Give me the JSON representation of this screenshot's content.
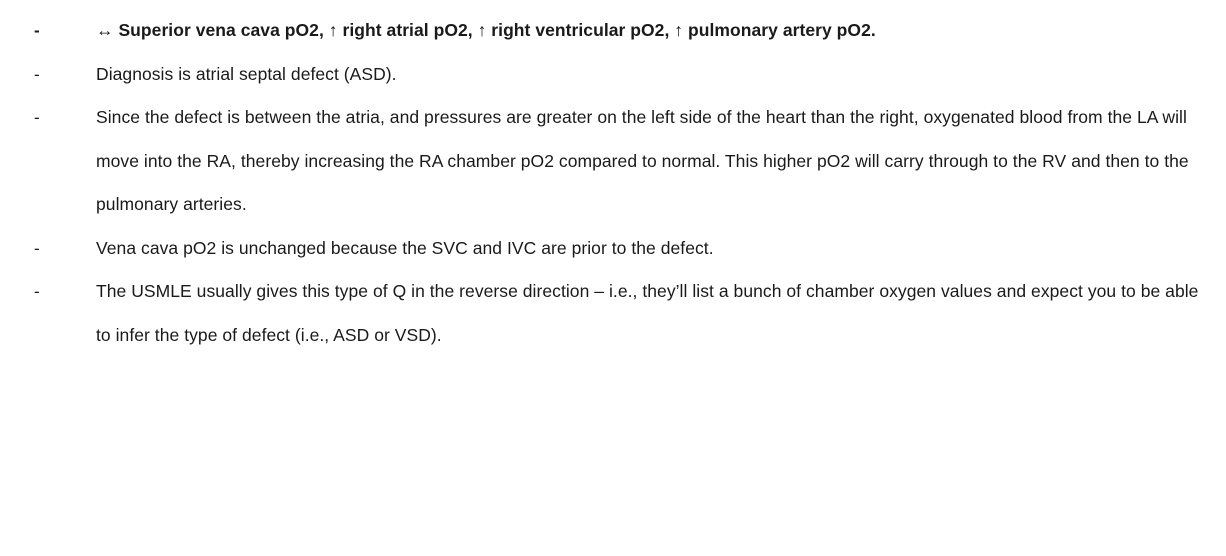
{
  "bullet_marker": "-",
  "items": [
    {
      "text": "↔ Superior vena cava pO2, ↑ right atrial pO2, ↑ right ventricular pO2, ↑ pulmonary artery pO2.",
      "bold": true
    },
    {
      "text": "Diagnosis is atrial septal defect (ASD).",
      "bold": false
    },
    {
      "text": "Since the defect is between the atria, and pressures are greater on the left side of the heart than the right, oxygenated blood from the LA will move into the RA, thereby increasing the RA chamber pO2 compared to normal. This higher pO2 will carry through to the RV and then to the pulmonary arteries.",
      "bold": false
    },
    {
      "text": "Vena cava pO2 is unchanged because the SVC and IVC are prior to the defect.",
      "bold": false
    },
    {
      "text": "The USMLE usually gives this type of Q in the reverse direction – i.e., they’ll list a bunch of chamber oxygen values and expect you to be able to infer the type of defect (i.e., ASD or VSD).",
      "bold": false
    }
  ]
}
